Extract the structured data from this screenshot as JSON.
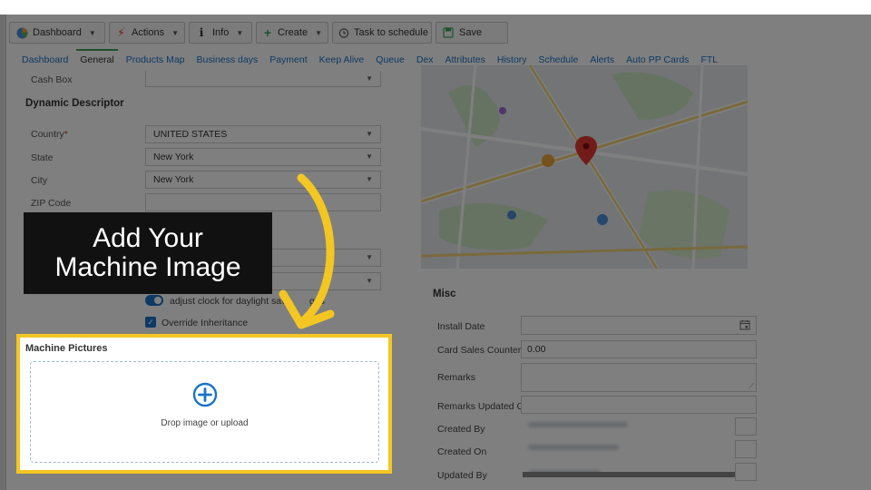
{
  "toolbar": {
    "buttons": [
      {
        "label": "Dashboard",
        "icon": "dashboard-icon",
        "dropdown": true
      },
      {
        "label": "Actions",
        "icon": "lightning-icon",
        "dropdown": true
      },
      {
        "label": "Info",
        "icon": "info-icon",
        "dropdown": true
      },
      {
        "label": "Create",
        "icon": "plus-icon",
        "dropdown": true
      },
      {
        "label": "Task to schedule",
        "icon": "clock-icon",
        "dropdown": false
      },
      {
        "label": "Save",
        "icon": "floppy-disk-icon",
        "dropdown": false
      }
    ]
  },
  "tabs": [
    "Dashboard",
    "General",
    "Products Map",
    "Business days",
    "Payment",
    "Keep Alive",
    "Queue",
    "Dex",
    "Attributes",
    "History",
    "Schedule",
    "Alerts",
    "Auto PP Cards",
    "FTL"
  ],
  "active_tab": "General",
  "form": {
    "cash_box_label": "Cash Box",
    "section_title": "Dynamic Descriptor",
    "country_label": "Country",
    "required_mark": "*",
    "country_value": "UNITED STATES",
    "state_label": "State",
    "state_value": "New York",
    "city_label": "City",
    "city_value": "New York",
    "zip_label": "ZIP Code",
    "zip_value": "",
    "daylight_label": "adjust clock for daylight savi",
    "daylight_label_tail": "ges",
    "override_label": "Override Inheritance"
  },
  "misc": {
    "title": "Misc",
    "install_date_label": "Install Date",
    "card_sales_label": "Card Sales Counter",
    "card_sales_value": "0.00",
    "remarks_label": "Remarks",
    "remarks_updated_label": "Remarks Updated On",
    "created_by_label": "Created By",
    "created_on_label": "Created On",
    "updated_by_label": "Updated By"
  },
  "pictures": {
    "title": "Machine Pictures",
    "drop_text": "Drop image or upload"
  },
  "callout": {
    "line1": "Add Your",
    "line2": "Machine Image"
  },
  "colors": {
    "highlight": "#f3c623",
    "link": "#1a73c8",
    "active_tab_bar": "#3aa35a",
    "upload_icon": "#1a73c8"
  }
}
